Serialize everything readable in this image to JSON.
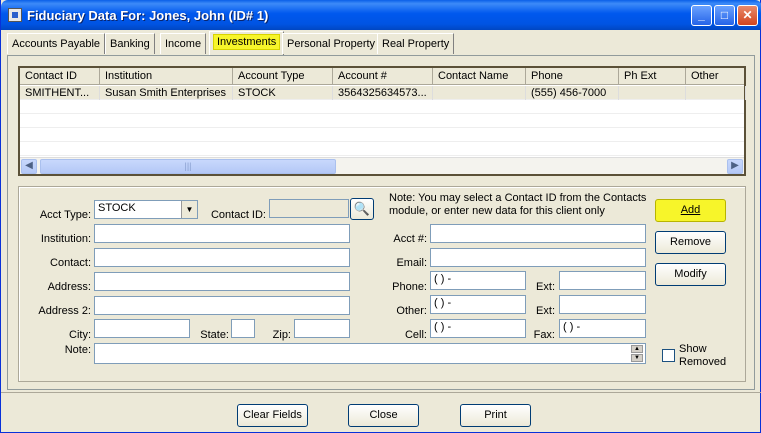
{
  "window": {
    "title": "Fiduciary Data For: Jones, John (ID# 1)"
  },
  "tabs": [
    "Accounts Payable",
    "Banking",
    "Income",
    "Investments",
    "Personal Property",
    "Real Property"
  ],
  "grid": {
    "columns": [
      "Contact ID",
      "Institution",
      "Account Type",
      "Account #",
      "Contact Name",
      "Phone",
      "Ph Ext",
      "Other"
    ],
    "rows": [
      {
        "contact_id": "SMITHENT...",
        "institution": "Susan Smith Enterprises",
        "account_type": "STOCK",
        "account_no": "3564325634573...",
        "contact_name": "",
        "phone": "(555) 456-7000",
        "ph_ext": "",
        "other": ""
      }
    ]
  },
  "form": {
    "acct_type_label": "Acct Type:",
    "acct_type_value": "STOCK",
    "contact_id_label": "Contact ID:",
    "note_text": "Note: You may select a Contact ID from the Contacts module, or enter new data for this client only",
    "institution_label": "Institution:",
    "contact_label": "Contact:",
    "address_label": "Address:",
    "address2_label": "Address 2:",
    "city_label": "City:",
    "state_label": "State:",
    "zip_label": "Zip:",
    "note_label": "Note:",
    "acct_no_label": "Acct #:",
    "email_label": "Email:",
    "phone_label": "Phone:",
    "other_label": "Other:",
    "cell_label": "Cell:",
    "ext_label": "Ext:",
    "fax_label": "Fax:",
    "phone_mask": "(  )   -",
    "show_removed_label": "Show Removed"
  },
  "buttons": {
    "add": "Add",
    "remove": "Remove",
    "modify": "Modify",
    "clear_fields": "Clear Fields",
    "close": "Close",
    "print": "Print"
  },
  "colors": {
    "highlight": "#f7f52a",
    "titlebar": "#0054e3"
  }
}
